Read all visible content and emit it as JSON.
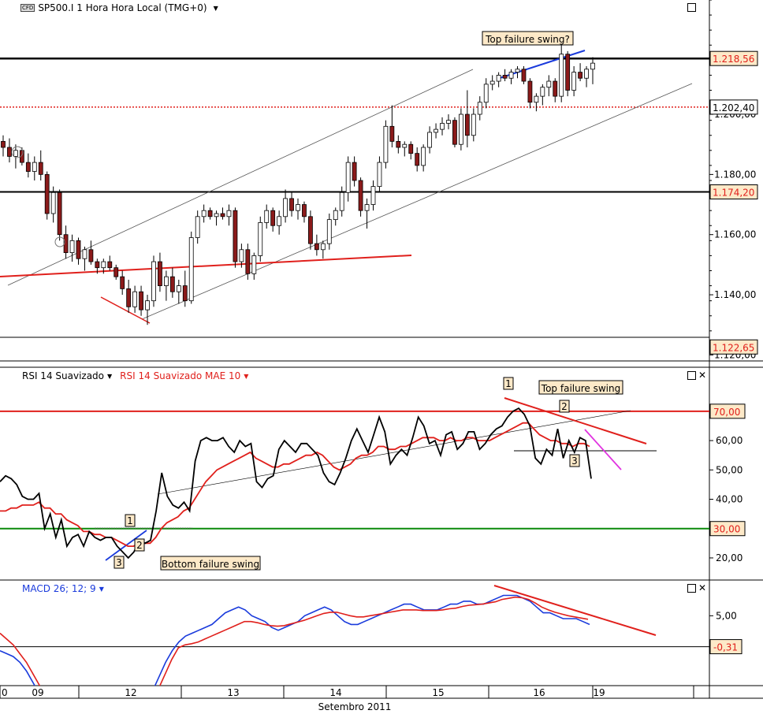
{
  "header": {
    "symbol_badge": "CFD",
    "title": "SP500.I 1 Hora Hora Local (TMG+0)",
    "rsi_label": "RSI 14 Suavizado",
    "rsi_mae_label": "RSI 14 Suavizado MAE 10",
    "macd_label": "MACD 26; 12; 9"
  },
  "colors": {
    "bull": "#ffffff",
    "bear": "#8b1a1a",
    "red": "#e0201c",
    "blue": "#1a3bdc",
    "green": "#0a8a0a",
    "magenta": "#e033e0"
  },
  "chart_data": [
    {
      "type": "candlestick",
      "panel": "price",
      "y_ticks": [
        "1.200,00",
        "1.180,00",
        "1.160,00",
        "1.140,00",
        "1.120,00"
      ],
      "ylim": [
        1118,
        1238
      ],
      "price_labels": [
        {
          "value": 1218.56,
          "text": "1.218,56"
        },
        {
          "value": 1202.4,
          "text": "1.202,40"
        },
        {
          "value": 1174.2,
          "text": "1.174,20"
        },
        {
          "value": 1122.65,
          "text": "1.122,65"
        }
      ],
      "annotations": [
        "Top failure swing?"
      ],
      "candles": [
        [
          1191,
          1193,
          1186,
          1189
        ],
        [
          1189,
          1192,
          1184,
          1186
        ],
        [
          1186,
          1190,
          1182,
          1188
        ],
        [
          1188,
          1189,
          1183,
          1184
        ],
        [
          1184,
          1187,
          1179,
          1181
        ],
        [
          1181,
          1186,
          1178,
          1184
        ],
        [
          1184,
          1188,
          1178,
          1180
        ],
        [
          1180,
          1181,
          1165,
          1167
        ],
        [
          1167,
          1176,
          1164,
          1174
        ],
        [
          1174,
          1175,
          1158,
          1160
        ],
        [
          1160,
          1163,
          1152,
          1154
        ],
        [
          1154,
          1160,
          1151,
          1158
        ],
        [
          1158,
          1159,
          1150,
          1152
        ],
        [
          1152,
          1156,
          1148,
          1155
        ],
        [
          1155,
          1158,
          1150,
          1151
        ],
        [
          1151,
          1152,
          1147,
          1149
        ],
        [
          1149,
          1152,
          1147,
          1151
        ],
        [
          1151,
          1153,
          1148,
          1149
        ],
        [
          1149,
          1150,
          1145,
          1146
        ],
        [
          1146,
          1148,
          1140,
          1142
        ],
        [
          1142,
          1145,
          1134,
          1136
        ],
        [
          1136,
          1143,
          1134,
          1141
        ],
        [
          1141,
          1143,
          1133,
          1135
        ],
        [
          1135,
          1140,
          1130,
          1138
        ],
        [
          1138,
          1153,
          1136,
          1151
        ],
        [
          1151,
          1154,
          1141,
          1143
        ],
        [
          1143,
          1148,
          1138,
          1146
        ],
        [
          1146,
          1149,
          1139,
          1141
        ],
        [
          1141,
          1145,
          1137,
          1143
        ],
        [
          1143,
          1148,
          1136,
          1138
        ],
        [
          1138,
          1161,
          1137,
          1159
        ],
        [
          1159,
          1168,
          1157,
          1166
        ],
        [
          1166,
          1170,
          1164,
          1168
        ],
        [
          1168,
          1169,
          1165,
          1166
        ],
        [
          1166,
          1168,
          1163,
          1167
        ],
        [
          1167,
          1169,
          1165,
          1166
        ],
        [
          1166,
          1170,
          1163,
          1168
        ],
        [
          1168,
          1169,
          1149,
          1151
        ],
        [
          1151,
          1157,
          1149,
          1155
        ],
        [
          1155,
          1157,
          1145,
          1147
        ],
        [
          1147,
          1154,
          1145,
          1153
        ],
        [
          1153,
          1166,
          1151,
          1164
        ],
        [
          1164,
          1170,
          1162,
          1168
        ],
        [
          1168,
          1169,
          1161,
          1163
        ],
        [
          1163,
          1168,
          1160,
          1166
        ],
        [
          1166,
          1175,
          1164,
          1172
        ],
        [
          1172,
          1174,
          1166,
          1168
        ],
        [
          1168,
          1172,
          1165,
          1170
        ],
        [
          1170,
          1171,
          1164,
          1166
        ],
        [
          1166,
          1168,
          1155,
          1157
        ],
        [
          1157,
          1160,
          1153,
          1155
        ],
        [
          1155,
          1158,
          1152,
          1157
        ],
        [
          1157,
          1167,
          1155,
          1165
        ],
        [
          1165,
          1169,
          1163,
          1168
        ],
        [
          1168,
          1176,
          1166,
          1174
        ],
        [
          1174,
          1186,
          1171,
          1184
        ],
        [
          1184,
          1186,
          1176,
          1178
        ],
        [
          1178,
          1179,
          1166,
          1168
        ],
        [
          1168,
          1172,
          1162,
          1170
        ],
        [
          1170,
          1178,
          1168,
          1176
        ],
        [
          1176,
          1186,
          1174,
          1184
        ],
        [
          1184,
          1198,
          1182,
          1196
        ],
        [
          1196,
          1203,
          1189,
          1191
        ],
        [
          1191,
          1193,
          1187,
          1189
        ],
        [
          1189,
          1191,
          1186,
          1190
        ],
        [
          1190,
          1191,
          1185,
          1187
        ],
        [
          1187,
          1189,
          1181,
          1183
        ],
        [
          1183,
          1190,
          1181,
          1189
        ],
        [
          1189,
          1196,
          1187,
          1194
        ],
        [
          1194,
          1197,
          1192,
          1195
        ],
        [
          1195,
          1199,
          1193,
          1197
        ],
        [
          1197,
          1200,
          1195,
          1198
        ],
        [
          1198,
          1199,
          1189,
          1190
        ],
        [
          1190,
          1202,
          1188,
          1200
        ],
        [
          1200,
          1208,
          1189,
          1193
        ],
        [
          1193,
          1202,
          1191,
          1200
        ],
        [
          1200,
          1206,
          1198,
          1204
        ],
        [
          1204,
          1212,
          1202,
          1210
        ],
        [
          1210,
          1213,
          1208,
          1211
        ],
        [
          1211,
          1214,
          1209,
          1213
        ],
        [
          1213,
          1215,
          1211,
          1212
        ],
        [
          1212,
          1215,
          1210,
          1214
        ],
        [
          1214,
          1216,
          1212,
          1215
        ],
        [
          1215,
          1216,
          1210,
          1211
        ],
        [
          1211,
          1212,
          1202,
          1204
        ],
        [
          1204,
          1207,
          1201,
          1206
        ],
        [
          1206,
          1210,
          1203,
          1209
        ],
        [
          1209,
          1213,
          1206,
          1211
        ],
        [
          1211,
          1212,
          1204,
          1206
        ],
        [
          1206,
          1224,
          1204,
          1220
        ],
        [
          1220,
          1221,
          1206,
          1208
        ],
        [
          1208,
          1216,
          1206,
          1214
        ],
        [
          1214,
          1217,
          1211,
          1212
        ],
        [
          1212,
          1216,
          1209,
          1215
        ],
        [
          1215,
          1219,
          1210,
          1217
        ]
      ]
    },
    {
      "type": "line",
      "panel": "rsi",
      "y_ticks": [
        "60,00",
        "50,00",
        "40,00",
        "20,00"
      ],
      "ylim": [
        13,
        85
      ],
      "level_labels": [
        {
          "value": 70,
          "text": "70,00"
        },
        {
          "value": 30,
          "text": "30,00"
        }
      ],
      "annotations": [
        "Top failure swing",
        "Bottom failure swing",
        "1",
        "2",
        "3",
        "3",
        "1",
        "2",
        "3"
      ],
      "series": [
        {
          "name": "RSI 14 Suavizado",
          "values": [
            46,
            48,
            47,
            45,
            41,
            40,
            40,
            42,
            30,
            35,
            27,
            33,
            24,
            27,
            28,
            24,
            29,
            27,
            26,
            27,
            27,
            24,
            22,
            20,
            22,
            26,
            25,
            26,
            36,
            49,
            41,
            38,
            37,
            39,
            36,
            53,
            60,
            61,
            60,
            60,
            61,
            58,
            56,
            60,
            58,
            59,
            46,
            44,
            47,
            48,
            57,
            60,
            58,
            56,
            59,
            59,
            57,
            55,
            49,
            46,
            45,
            49,
            54,
            60,
            64,
            60,
            56,
            62,
            68,
            63,
            52,
            55,
            57,
            55,
            61,
            68,
            65,
            59,
            60,
            55,
            62,
            63,
            57,
            59,
            63,
            63,
            57,
            59,
            62,
            64,
            65,
            68,
            70,
            71,
            69,
            65,
            54,
            52,
            57,
            55,
            64,
            54,
            60,
            56,
            61,
            60,
            47
          ]
        },
        {
          "name": "RSI 14 Suavizado MAE 10",
          "values": [
            36,
            36,
            37,
            37,
            38,
            38,
            38,
            39,
            37,
            37,
            35,
            35,
            33,
            32,
            31,
            29,
            29,
            28,
            28,
            27,
            27,
            26,
            25,
            24,
            24,
            25,
            25,
            25,
            27,
            30,
            32,
            33,
            34,
            36,
            37,
            40,
            43,
            46,
            48,
            50,
            51,
            52,
            53,
            54,
            55,
            56,
            54,
            53,
            52,
            51,
            51,
            52,
            52,
            53,
            54,
            55,
            55,
            56,
            55,
            53,
            51,
            50,
            51,
            52,
            54,
            55,
            55,
            56,
            58,
            58,
            57,
            57,
            58,
            58,
            59,
            60,
            61,
            61,
            61,
            60,
            60,
            61,
            60,
            60,
            61,
            61,
            60,
            60,
            60,
            61,
            62,
            63,
            64,
            65,
            66,
            66,
            64,
            62,
            61,
            60,
            60,
            59,
            59,
            58,
            59,
            59,
            58
          ]
        }
      ]
    },
    {
      "type": "line",
      "panel": "macd",
      "x_tick_labels": [
        "09",
        "12",
        "13",
        "14",
        "15",
        "16",
        "19"
      ],
      "x_axis_title": "Setembro 2011",
      "y_ticks": [
        "5,00"
      ],
      "ylim": [
        -7,
        11
      ],
      "level_labels": [
        {
          "value": -0.31,
          "text": "-0,31"
        }
      ],
      "series": [
        {
          "name": "MACD",
          "values": [
            -1.0,
            -1.5,
            -2.0,
            -3.0,
            -4.5,
            -6.5,
            -8.5,
            -10.5,
            -12.5,
            -13.5,
            -14.5,
            -15.5,
            -16.0,
            -16.5,
            -17.0,
            -17.0,
            -16.5,
            -16.0,
            -15.5,
            -15.0,
            -14.0,
            -12.5,
            -10.5,
            -8.0,
            -5.5,
            -3.0,
            -1.0,
            0.5,
            1.5,
            2.0,
            2.5,
            3.0,
            3.5,
            4.5,
            5.5,
            6.0,
            6.5,
            6.0,
            5.0,
            4.5,
            4.0,
            3.0,
            2.5,
            3.0,
            3.5,
            4.0,
            5.0,
            5.5,
            6.0,
            6.5,
            6.0,
            5.0,
            4.0,
            3.5,
            3.5,
            4.0,
            4.5,
            5.0,
            5.5,
            6.0,
            6.5,
            7.0,
            7.0,
            6.5,
            6.0,
            6.0,
            6.0,
            6.5,
            7.0,
            7.0,
            7.5,
            7.5,
            7.0,
            7.0,
            7.5,
            8.0,
            8.5,
            8.5,
            8.5,
            8.0,
            7.5,
            6.5,
            5.5,
            5.5,
            5.0,
            4.5,
            4.5,
            4.5,
            4.0,
            3.5
          ]
        },
        {
          "name": "Signal",
          "values": [
            2.0,
            1.0,
            0.0,
            -1.5,
            -3.0,
            -5.0,
            -7.0,
            -9.0,
            -11.0,
            -12.5,
            -14.0,
            -15.0,
            -16.0,
            -16.5,
            -17.0,
            -17.0,
            -17.0,
            -16.5,
            -16.0,
            -15.5,
            -14.5,
            -13.0,
            -11.5,
            -9.5,
            -7.5,
            -5.0,
            -2.5,
            -0.5,
            0.0,
            0.2,
            0.5,
            1.0,
            1.5,
            2.0,
            2.5,
            3.0,
            3.5,
            4.0,
            4.0,
            3.8,
            3.5,
            3.3,
            3.2,
            3.3,
            3.6,
            3.9,
            4.2,
            4.6,
            5.0,
            5.4,
            5.6,
            5.6,
            5.3,
            5.0,
            4.8,
            4.8,
            5.0,
            5.2,
            5.4,
            5.6,
            5.8,
            6.0,
            6.0,
            6.0,
            5.9,
            5.9,
            5.9,
            6.0,
            6.2,
            6.3,
            6.6,
            6.8,
            6.9,
            7.0,
            7.2,
            7.4,
            7.8,
            8.0,
            8.2,
            8.1,
            7.8,
            7.2,
            6.5,
            6.0,
            5.6,
            5.3,
            5.0,
            4.8,
            4.6,
            4.4
          ]
        }
      ]
    }
  ]
}
